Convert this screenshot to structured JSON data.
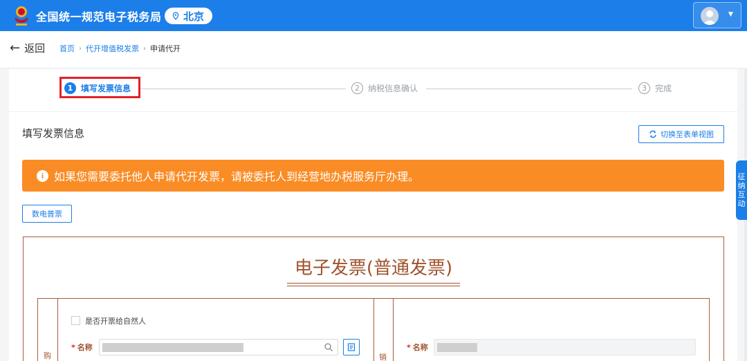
{
  "header": {
    "title": "全国统一规范电子税务局",
    "city": "北京"
  },
  "nav": {
    "back_label": "返回",
    "breadcrumbs": [
      "首页",
      "代开增值税发票",
      "申请代开"
    ]
  },
  "steps": [
    {
      "num": "1",
      "label": "填写发票信息",
      "active": true
    },
    {
      "num": "2",
      "label": "纳税信息确认",
      "active": false
    },
    {
      "num": "3",
      "label": "完成",
      "active": false
    }
  ],
  "section": {
    "title": "填写发票信息",
    "switch_label": "切换至表单视图"
  },
  "notice": {
    "text": "如果您需要委托他人申请代开发票，请被委托人到经营地办税服务厅办理。"
  },
  "invoice_type_label": "数电普票",
  "invoice": {
    "title": "电子发票(普通发票)",
    "buyer_side": "购",
    "seller_side": "销",
    "natural_person_label": "是否开票给自然人",
    "buyer_name_label": "名称",
    "seller_name_label": "名称",
    "required_mark": "*"
  },
  "float_tab": {
    "chars": [
      "征",
      "纳",
      "互",
      "动"
    ]
  },
  "colors": {
    "primary": "#1b7ee9",
    "notice": "#fa8c25",
    "invoice_brown": "#a0522d",
    "highlight": "#e3202a"
  }
}
